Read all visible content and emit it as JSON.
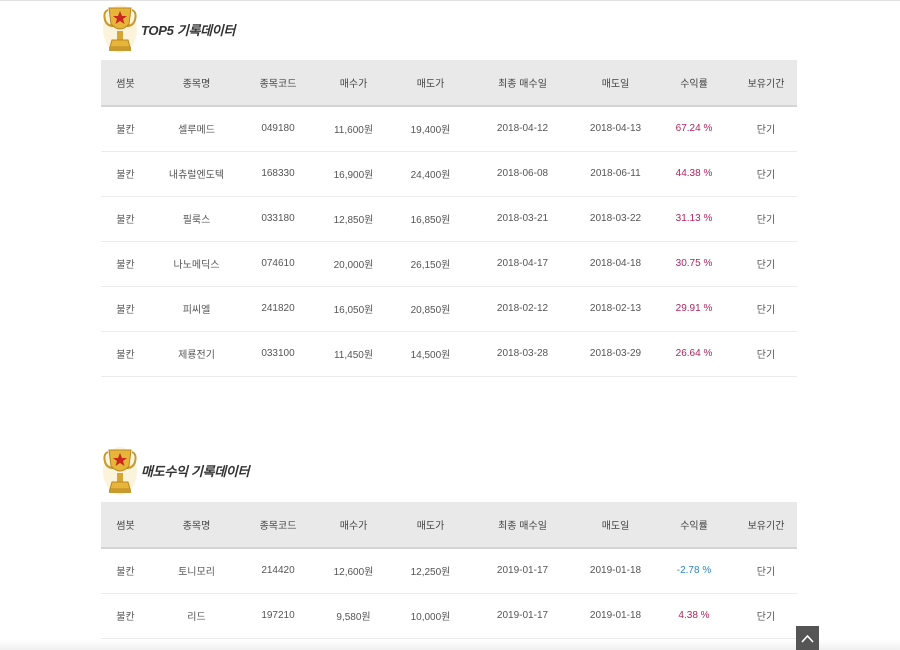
{
  "headers": [
    "썸봇",
    "종목명",
    "종목코드",
    "매수가",
    "매도가",
    "최종 매수일",
    "매도일",
    "수익률",
    "보유기간"
  ],
  "section1": {
    "title": "TOP5 기록데이터",
    "rows": [
      {
        "bot": "불칸",
        "name": "셀루메드",
        "code": "049180",
        "buy": "11,600원",
        "sell": "19,400원",
        "last_buy": "2018-04-12",
        "sell_date": "2018-04-13",
        "ret": "67.24 %",
        "period": "단기"
      },
      {
        "bot": "불칸",
        "name": "내츄럴엔도텍",
        "code": "168330",
        "buy": "16,900원",
        "sell": "24,400원",
        "last_buy": "2018-06-08",
        "sell_date": "2018-06-11",
        "ret": "44.38 %",
        "period": "단기"
      },
      {
        "bot": "불칸",
        "name": "필룩스",
        "code": "033180",
        "buy": "12,850원",
        "sell": "16,850원",
        "last_buy": "2018-03-21",
        "sell_date": "2018-03-22",
        "ret": "31.13 %",
        "period": "단기"
      },
      {
        "bot": "불칸",
        "name": "나노메딕스",
        "code": "074610",
        "buy": "20,000원",
        "sell": "26,150원",
        "last_buy": "2018-04-17",
        "sell_date": "2018-04-18",
        "ret": "30.75 %",
        "period": "단기"
      },
      {
        "bot": "불칸",
        "name": "피씨엘",
        "code": "241820",
        "buy": "16,050원",
        "sell": "20,850원",
        "last_buy": "2018-02-12",
        "sell_date": "2018-02-13",
        "ret": "29.91 %",
        "period": "단기"
      },
      {
        "bot": "불칸",
        "name": "제룡전기",
        "code": "033100",
        "buy": "11,450원",
        "sell": "14,500원",
        "last_buy": "2018-03-28",
        "sell_date": "2018-03-29",
        "ret": "26.64 %",
        "period": "단기"
      }
    ]
  },
  "section2": {
    "title": "매도수익 기록데이터",
    "rows": [
      {
        "bot": "불칸",
        "name": "토니모리",
        "code": "214420",
        "buy": "12,600원",
        "sell": "12,250원",
        "last_buy": "2019-01-17",
        "sell_date": "2019-01-18",
        "ret": "-2.78 %",
        "period": "단기"
      },
      {
        "bot": "불칸",
        "name": "리드",
        "code": "197210",
        "buy": "9,580원",
        "sell": "10,000원",
        "last_buy": "2019-01-17",
        "sell_date": "2019-01-18",
        "ret": "4.38 %",
        "period": "단기"
      }
    ]
  },
  "colors": {
    "positive": "#b0245f",
    "negative": "#2a86c9",
    "header_bg": "#e9e9e9"
  },
  "icons": {
    "trophy": "trophy-icon",
    "scroll_top": "chevron-up-icon"
  }
}
